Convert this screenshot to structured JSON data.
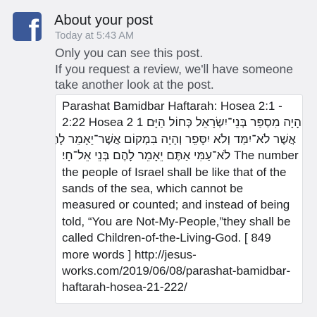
{
  "notification": {
    "title": "About your post",
    "timestamp": "Today at 5:43 AM",
    "message_lines": [
      "Only you can see this post.",
      "If you request a review, we'll have someone",
      "take another look at the post."
    ]
  },
  "post": {
    "lines": [
      "Parashat Bamidbar Haftarah: Hosea 2:1 -",
      "2:22 Hosea 2 1 וְהָיָה מִסְפַּר בְּנֵי־יִשְׂרָאֵל כְּחוֹל הַיָּם",
      "אֲשֶׁר לֹא־יִמַּד וְלֹא יִסָּפֵר וְהָיָה בִּמְקוֹם אֲשֶׁר־יֵאָמֵר לָהֶם",
      "לֹא־עַמִּי אַתֶּם יֵאָמֵר לָהֶם בְּנֵי אֵל־חָי׃ The number of",
      "the people of Israel shall be like that of the",
      "sands of the sea, which cannot be",
      "measured or counted; and instead of being",
      "told, “You are Not-My-People,”they shall be",
      "called Children-of-the-Living-God. [ 849",
      "more words ] http://jesus-",
      "works.com/2019/06/08/parashat-bamidbar-",
      "haftarah-hosea-21-222/"
    ]
  },
  "logo": {
    "icon": "facebook-logo-icon",
    "glyph": "f",
    "color": "#3b5998"
  }
}
